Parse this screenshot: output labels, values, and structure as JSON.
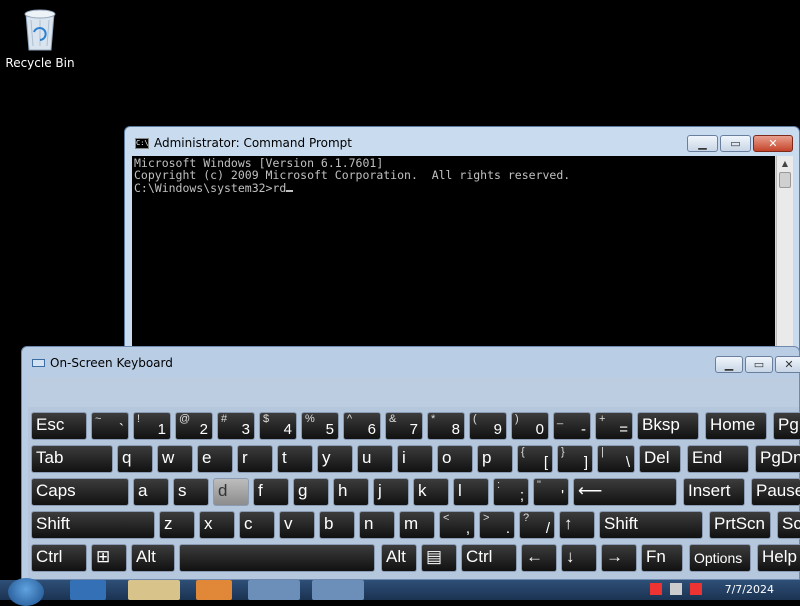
{
  "desktop": {
    "recycle_bin_label": "Recycle Bin"
  },
  "cmd": {
    "title": "Administrator: Command Prompt",
    "icon_text": "C:\\",
    "lines": [
      "Microsoft Windows [Version 6.1.7601]",
      "Copyright (c) 2009 Microsoft Corporation.  All rights reserved.",
      "",
      "C:\\Windows\\system32>rd"
    ]
  },
  "osk": {
    "title": "On-Screen Keyboard",
    "rows": [
      [
        {
          "main": "Esc"
        },
        {
          "upper": "~",
          "lower": "`"
        },
        {
          "upper": "!",
          "lower": "1"
        },
        {
          "upper": "@",
          "lower": "2"
        },
        {
          "upper": "#",
          "lower": "3"
        },
        {
          "upper": "$",
          "lower": "4"
        },
        {
          "upper": "%",
          "lower": "5"
        },
        {
          "upper": "^",
          "lower": "6"
        },
        {
          "upper": "&",
          "lower": "7"
        },
        {
          "upper": "*",
          "lower": "8"
        },
        {
          "upper": "(",
          "lower": "9"
        },
        {
          "upper": ")",
          "lower": "0"
        },
        {
          "upper": "_",
          "lower": "-"
        },
        {
          "upper": "+",
          "lower": "="
        },
        {
          "main": "Bksp"
        },
        {
          "main": "Home"
        },
        {
          "main": "PgUp"
        }
      ],
      [
        {
          "main": "Tab"
        },
        {
          "main": "q"
        },
        {
          "main": "w"
        },
        {
          "main": "e"
        },
        {
          "main": "r"
        },
        {
          "main": "t"
        },
        {
          "main": "y"
        },
        {
          "main": "u"
        },
        {
          "main": "i"
        },
        {
          "main": "o"
        },
        {
          "main": "p"
        },
        {
          "upper": "{",
          "lower": "["
        },
        {
          "upper": "}",
          "lower": "]"
        },
        {
          "upper": "|",
          "lower": "\\"
        },
        {
          "main": "Del"
        },
        {
          "main": "End"
        },
        {
          "main": "PgDn"
        }
      ],
      [
        {
          "main": "Caps"
        },
        {
          "main": "a"
        },
        {
          "main": "s"
        },
        {
          "main": "d",
          "pressed": true
        },
        {
          "main": "f"
        },
        {
          "main": "g"
        },
        {
          "main": "h"
        },
        {
          "main": "j"
        },
        {
          "main": "k"
        },
        {
          "main": "l"
        },
        {
          "upper": ":",
          "lower": ";"
        },
        {
          "upper": "\"",
          "lower": "'"
        },
        {
          "main": "⟵"
        },
        {
          "main": "Insert"
        },
        {
          "main": "Pause"
        }
      ],
      [
        {
          "main": "Shift"
        },
        {
          "main": "z"
        },
        {
          "main": "x"
        },
        {
          "main": "c"
        },
        {
          "main": "v"
        },
        {
          "main": "b"
        },
        {
          "main": "n"
        },
        {
          "main": "m"
        },
        {
          "upper": "<",
          "lower": ","
        },
        {
          "upper": ">",
          "lower": "."
        },
        {
          "upper": "?",
          "lower": "/"
        },
        {
          "main": "↑"
        },
        {
          "main": "Shift"
        },
        {
          "main": "PrtScn"
        },
        {
          "main": "ScrLk"
        }
      ],
      [
        {
          "main": "Ctrl"
        },
        {
          "main": "⊞"
        },
        {
          "main": "Alt"
        },
        {
          "main": ""
        },
        {
          "main": "Alt"
        },
        {
          "main": "▤"
        },
        {
          "main": "Ctrl"
        },
        {
          "main": "←"
        },
        {
          "main": "↓"
        },
        {
          "main": "→"
        },
        {
          "main": "Fn"
        },
        {
          "main": "Options"
        },
        {
          "main": "Help"
        }
      ]
    ]
  },
  "taskbar": {
    "date": "7/7/2024"
  }
}
